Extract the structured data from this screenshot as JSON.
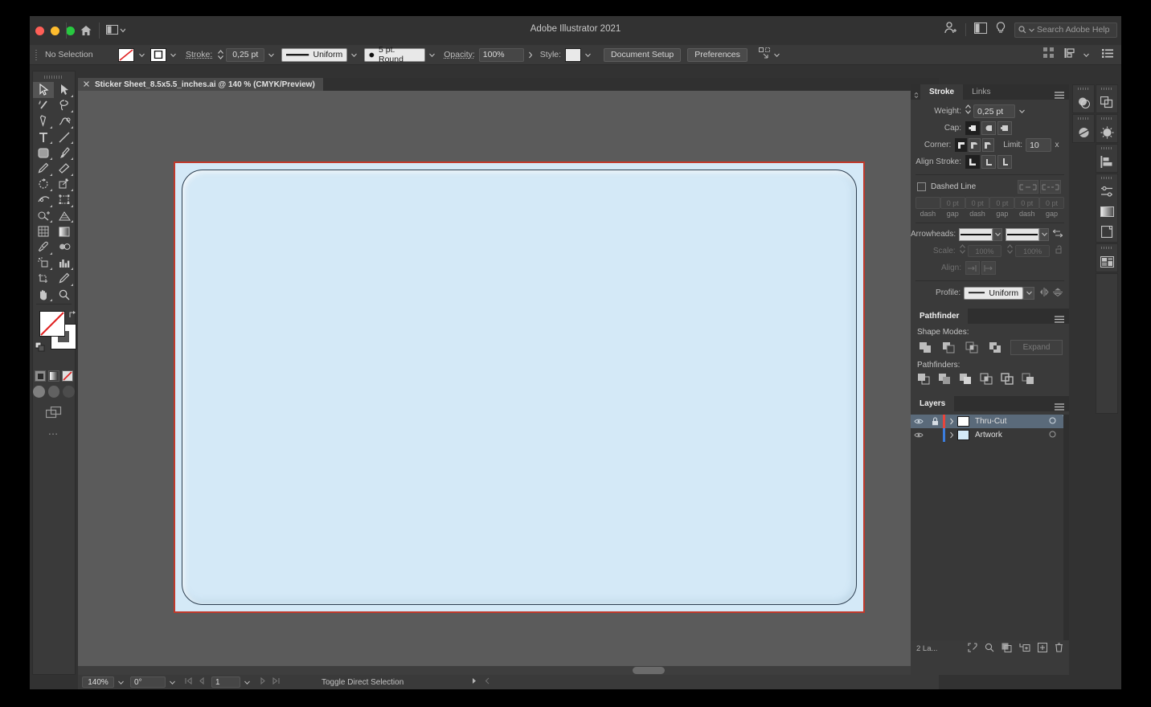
{
  "window": {
    "title": "Adobe Illustrator 2021",
    "traffic_lights": [
      "close",
      "minimize",
      "maximize"
    ],
    "home_icon": "home-icon",
    "arrange_icon": "arrange-documents-icon",
    "account_icon": "account-icon",
    "screen_mode_icon": "screen-mode-icon",
    "discover_icon": "discover-bulb-icon",
    "search": {
      "placeholder": "Search Adobe Help",
      "value": "Search Adobe Help",
      "icon": "search-icon"
    }
  },
  "control_bar": {
    "selection_status": "No Selection",
    "fill_label": "fill-swatch",
    "stroke_swatch_label": "stroke-swatch",
    "stroke_label": "Stroke:",
    "stroke_weight": "0,25 pt",
    "profile_value": "Uniform",
    "brush_value": "5 pt. Round",
    "opacity_label": "Opacity:",
    "opacity_value": "100%",
    "style_label": "Style:",
    "document_setup": "Document Setup",
    "preferences": "Preferences",
    "select_similar_icon": "select-similar-icon",
    "align_icon": "align-icon",
    "distribute_icon": "distribute-icon",
    "options_icon": "panel-options-icon"
  },
  "tools": {
    "label": "Tools",
    "items": [
      {
        "name": "selection-tool",
        "glyph": "arrow",
        "selected": true
      },
      {
        "name": "direct-selection-tool",
        "glyph": "arrow-white",
        "selected": false
      },
      {
        "name": "magic-wand-tool",
        "glyph": "wand",
        "selected": false
      },
      {
        "name": "lasso-tool",
        "glyph": "lasso",
        "selected": false
      },
      {
        "name": "pen-tool",
        "glyph": "pen",
        "selected": false
      },
      {
        "name": "curvature-tool",
        "glyph": "curvature",
        "selected": false
      },
      {
        "name": "type-tool",
        "glyph": "T",
        "selected": false
      },
      {
        "name": "line-segment-tool",
        "glyph": "line",
        "selected": false
      },
      {
        "name": "rectangle-tool",
        "glyph": "rect",
        "selected": false
      },
      {
        "name": "paintbrush-tool",
        "glyph": "brush",
        "selected": false
      },
      {
        "name": "pencil-tool",
        "glyph": "pencil",
        "selected": false
      },
      {
        "name": "eraser-tool",
        "glyph": "eraser",
        "selected": false
      },
      {
        "name": "rotate-tool",
        "glyph": "rotate",
        "selected": false
      },
      {
        "name": "scale-tool",
        "glyph": "scale",
        "selected": false
      },
      {
        "name": "width-tool",
        "glyph": "width",
        "selected": false
      },
      {
        "name": "free-transform-tool",
        "glyph": "transform",
        "selected": false
      },
      {
        "name": "shape-builder-tool",
        "glyph": "shapebuilder",
        "selected": false
      },
      {
        "name": "perspective-grid-tool",
        "glyph": "perspective",
        "selected": false
      },
      {
        "name": "mesh-tool",
        "glyph": "mesh",
        "selected": false
      },
      {
        "name": "gradient-tool",
        "glyph": "gradient",
        "selected": false
      },
      {
        "name": "eyedropper-tool",
        "glyph": "eyedropper",
        "selected": false
      },
      {
        "name": "blend-tool",
        "glyph": "blend",
        "selected": false
      },
      {
        "name": "symbol-sprayer-tool",
        "glyph": "sprayer",
        "selected": false
      },
      {
        "name": "column-graph-tool",
        "glyph": "graph",
        "selected": false
      },
      {
        "name": "artboard-tool",
        "glyph": "artboard",
        "selected": false
      },
      {
        "name": "slice-tool",
        "glyph": "slice",
        "selected": false
      },
      {
        "name": "hand-tool",
        "glyph": "hand",
        "selected": false
      },
      {
        "name": "zoom-tool",
        "glyph": "zoom",
        "selected": false
      }
    ],
    "color_modes": [
      "color-mode-icon",
      "gradient-mode-icon",
      "none-mode-icon"
    ],
    "draw_modes": [
      "draw-normal-icon",
      "draw-behind-icon",
      "draw-inside-icon"
    ],
    "screen_mode_icon": "change-screen-mode-icon",
    "more_tools": "…"
  },
  "document_tab": {
    "close_icon": "close-icon",
    "title": "Sticker Sheet_8.5x5.5_inches.ai @ 140 % (CMYK/Preview)"
  },
  "canvas": {
    "artboard_border_color": "#c0392b",
    "artwork_fill": "#d4e9f7",
    "artwork_stroke": "#2c3e50"
  },
  "stroke_panel": {
    "tabs": [
      {
        "label": "Stroke",
        "active": true
      },
      {
        "label": "Links",
        "active": false
      }
    ],
    "menu_icon": "panel-menu-icon",
    "weight_label": "Weight:",
    "weight_value": "0,25 pt",
    "cap_label": "Cap:",
    "caps": [
      "butt-cap-icon",
      "round-cap-icon",
      "projecting-cap-icon"
    ],
    "cap_selected": 0,
    "corner_label": "Corner:",
    "corners": [
      "miter-join-icon",
      "round-join-icon",
      "bevel-join-icon"
    ],
    "corner_selected": 0,
    "limit_label": "Limit:",
    "limit_value": "10",
    "limit_unit": "x",
    "align_label": "Align Stroke:",
    "aligns": [
      "align-center-icon",
      "align-inside-icon",
      "align-outside-icon"
    ],
    "align_selected": 0,
    "dashed_label": "Dashed Line",
    "dashed_checked": false,
    "dash_gap_buttons": [
      "dash-preserve-icon",
      "dash-exact-icon"
    ],
    "dash_values": [
      "",
      "0 pt",
      "0 pt",
      "0 pt",
      "0 pt",
      "0 pt"
    ],
    "dash_captions": [
      "dash",
      "gap",
      "dash",
      "gap",
      "dash",
      "gap"
    ],
    "arrowheads_label": "Arrowheads:",
    "arrowhead_start": "arrowhead-none",
    "arrowhead_end": "arrowhead-none",
    "swap_icon": "swap-arrowheads-icon",
    "scale_label": "Scale:",
    "scale_start": "100%",
    "scale_end": "100%",
    "link_icon": "link-scales-icon",
    "align_dash_label": "Align:",
    "align_dash_icons": [
      "extend-arrows-icon",
      "place-arrows-icon"
    ],
    "profile_label": "Profile:",
    "profile_value": "Uniform",
    "flip_x_icon": "flip-across-icon",
    "flip_y_icon": "flip-along-icon"
  },
  "pathfinder_panel": {
    "title": "Pathfinder",
    "menu_icon": "panel-menu-icon",
    "shape_modes_label": "Shape Modes:",
    "shape_modes": [
      "unite-icon",
      "minus-front-icon",
      "intersect-icon",
      "exclude-icon"
    ],
    "expand_label": "Expand",
    "pathfinders_label": "Pathfinders:",
    "pathfinders": [
      "divide-icon",
      "trim-icon",
      "merge-icon",
      "crop-icon",
      "outline-icon",
      "minus-back-icon"
    ]
  },
  "layers_panel": {
    "title": "Layers",
    "menu_icon": "panel-menu-icon",
    "rows": [
      {
        "name": "Thru-Cut",
        "visible": true,
        "locked": true,
        "color": "#e8453c",
        "thumb": "#ffffff",
        "selected": true,
        "target": "target-circle-icon"
      },
      {
        "name": "Artwork",
        "visible": true,
        "locked": false,
        "color": "#3b7ddd",
        "thumb": "#d4e9f7",
        "selected": false,
        "target": "target-circle-icon"
      }
    ],
    "count_label": "2 La...",
    "footer_icons": [
      "locate-object-icon",
      "search-icon",
      "make-clipping-mask-icon",
      "create-sublayer-icon",
      "create-new-layer-icon",
      "delete-selection-icon"
    ]
  },
  "dock": {
    "left_column": [
      {
        "name": "swatches-icon"
      },
      {
        "name": "color-guide-icon"
      }
    ],
    "right_column": [
      {
        "name": "layers-dock-icon"
      },
      {
        "name": "brushes-icon"
      },
      {
        "name": "align-dock-icon"
      },
      {
        "name": "transparency-icon"
      },
      {
        "name": "gradient-dock-icon"
      },
      {
        "name": "artboards-icon"
      },
      {
        "name": "libraries-icon"
      }
    ]
  },
  "status_bar": {
    "zoom": "140%",
    "rotation": "0°",
    "artboard_number": "1",
    "nav_first_icon": "first-artboard-icon",
    "nav_prev_icon": "previous-artboard-icon",
    "nav_next_icon": "next-artboard-icon",
    "nav_last_icon": "last-artboard-icon",
    "status_text": "Toggle Direct Selection",
    "play_icon": "play-icon",
    "back_icon": "back-icon"
  }
}
